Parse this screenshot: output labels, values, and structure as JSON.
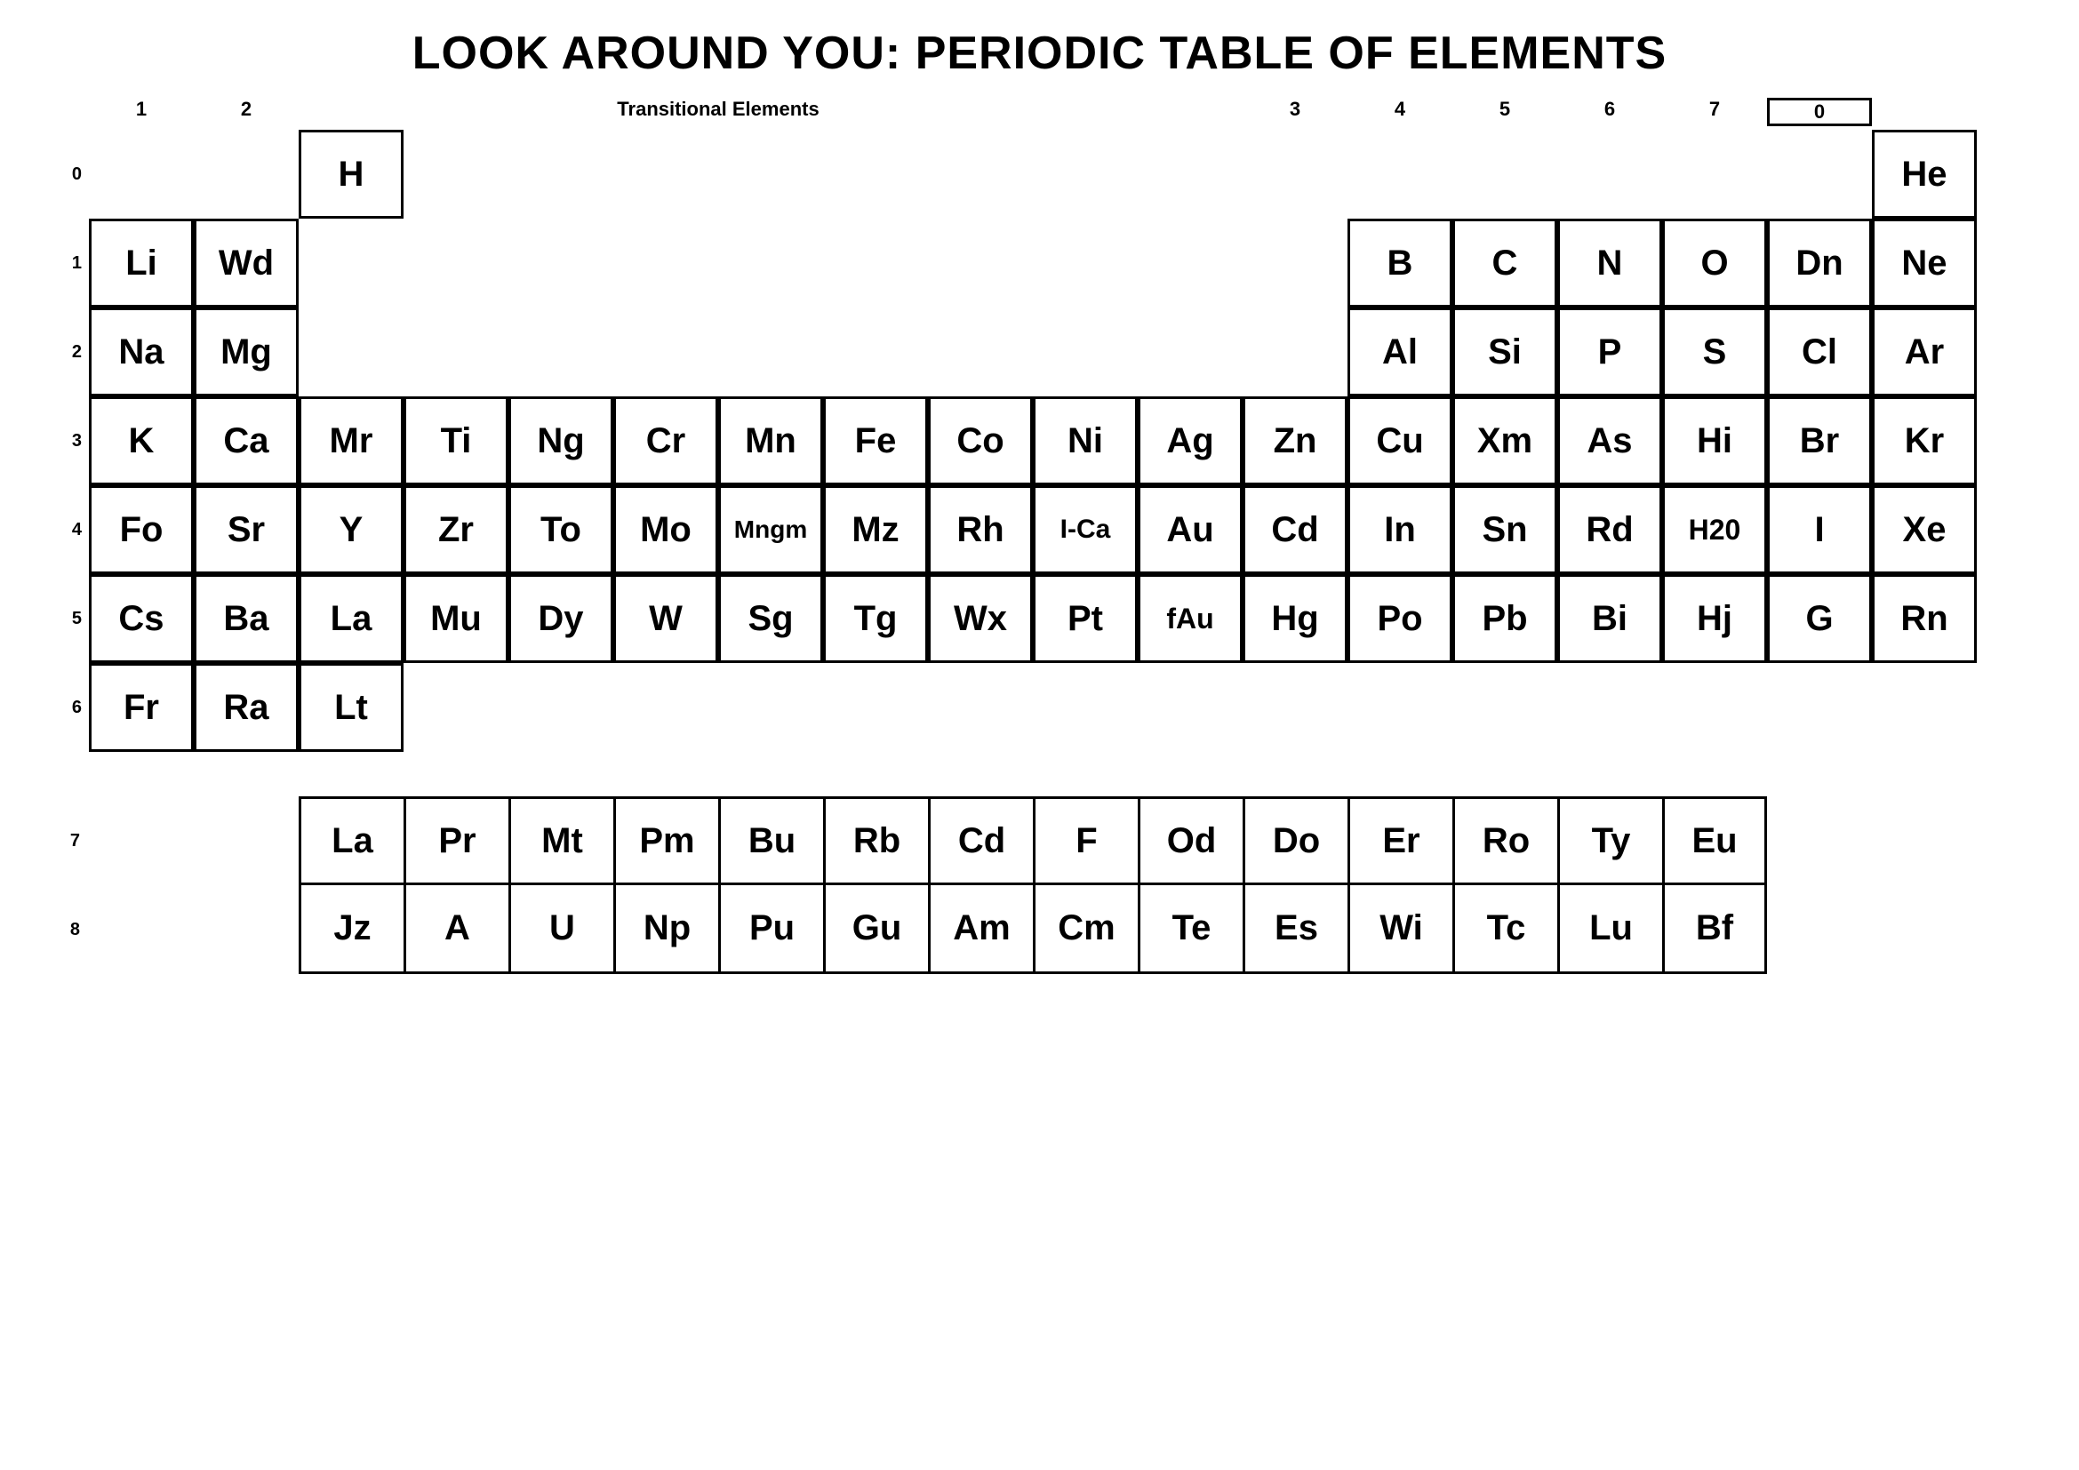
{
  "title": "LOOK AROUND YOU: PERIODIC TABLE OF ELEMENTS",
  "transitional_label": "Transitional Elements",
  "col_headers": [
    "1",
    "2",
    "",
    "",
    "",
    "",
    "",
    "",
    "",
    "",
    "",
    "",
    "3",
    "4",
    "5",
    "6",
    "7",
    "0"
  ],
  "rows": [
    {
      "label": "0",
      "cells": [
        {
          "symbol": "",
          "group": "empty"
        },
        {
          "symbol": "",
          "group": "empty"
        },
        {
          "symbol": "H",
          "group": "box"
        },
        {
          "symbol": "",
          "group": "empty"
        },
        {
          "symbol": "",
          "group": "empty"
        },
        {
          "symbol": "",
          "group": "empty"
        },
        {
          "symbol": "",
          "group": "empty"
        },
        {
          "symbol": "",
          "group": "empty"
        },
        {
          "symbol": "",
          "group": "empty"
        },
        {
          "symbol": "",
          "group": "empty"
        },
        {
          "symbol": "",
          "group": "empty"
        },
        {
          "symbol": "",
          "group": "empty"
        },
        {
          "symbol": "",
          "group": "empty"
        },
        {
          "symbol": "",
          "group": "empty"
        },
        {
          "symbol": "",
          "group": "empty"
        },
        {
          "symbol": "",
          "group": "empty"
        },
        {
          "symbol": "",
          "group": "empty"
        },
        {
          "symbol": "He",
          "group": "box"
        }
      ]
    },
    {
      "label": "1",
      "cells": [
        {
          "symbol": "Li",
          "group": "box"
        },
        {
          "symbol": "Wd",
          "group": "box"
        },
        {
          "symbol": "",
          "group": "empty"
        },
        {
          "symbol": "",
          "group": "empty"
        },
        {
          "symbol": "",
          "group": "empty"
        },
        {
          "symbol": "",
          "group": "empty"
        },
        {
          "symbol": "",
          "group": "empty"
        },
        {
          "symbol": "",
          "group": "empty"
        },
        {
          "symbol": "",
          "group": "empty"
        },
        {
          "symbol": "",
          "group": "empty"
        },
        {
          "symbol": "",
          "group": "empty"
        },
        {
          "symbol": "",
          "group": "empty"
        },
        {
          "symbol": "B",
          "group": "box"
        },
        {
          "symbol": "C",
          "group": "box"
        },
        {
          "symbol": "N",
          "group": "box"
        },
        {
          "symbol": "O",
          "group": "box"
        },
        {
          "symbol": "Dn",
          "group": "box"
        },
        {
          "symbol": "Ne",
          "group": "box"
        }
      ]
    },
    {
      "label": "2",
      "cells": [
        {
          "symbol": "Na",
          "group": "box"
        },
        {
          "symbol": "Mg",
          "group": "box"
        },
        {
          "symbol": "",
          "group": "empty"
        },
        {
          "symbol": "",
          "group": "empty"
        },
        {
          "symbol": "",
          "group": "empty"
        },
        {
          "symbol": "",
          "group": "empty"
        },
        {
          "symbol": "",
          "group": "empty"
        },
        {
          "symbol": "",
          "group": "empty"
        },
        {
          "symbol": "",
          "group": "empty"
        },
        {
          "symbol": "",
          "group": "empty"
        },
        {
          "symbol": "",
          "group": "empty"
        },
        {
          "symbol": "",
          "group": "empty"
        },
        {
          "symbol": "Al",
          "group": "box"
        },
        {
          "symbol": "Si",
          "group": "box"
        },
        {
          "symbol": "P",
          "group": "box"
        },
        {
          "symbol": "S",
          "group": "box"
        },
        {
          "symbol": "Cl",
          "group": "box"
        },
        {
          "symbol": "Ar",
          "group": "box"
        }
      ]
    },
    {
      "label": "3",
      "cells": [
        {
          "symbol": "K",
          "group": "box"
        },
        {
          "symbol": "Ca",
          "group": "box"
        },
        {
          "symbol": "Mr",
          "group": "box"
        },
        {
          "symbol": "Ti",
          "group": "box"
        },
        {
          "symbol": "Ng",
          "group": "box"
        },
        {
          "symbol": "Cr",
          "group": "box"
        },
        {
          "symbol": "Mn",
          "group": "box"
        },
        {
          "symbol": "Fe",
          "group": "box"
        },
        {
          "symbol": "Co",
          "group": "box"
        },
        {
          "symbol": "Ni",
          "group": "box"
        },
        {
          "symbol": "Ag",
          "group": "box"
        },
        {
          "symbol": "Zn",
          "group": "box"
        },
        {
          "symbol": "Cu",
          "group": "box"
        },
        {
          "symbol": "Xm",
          "group": "box"
        },
        {
          "symbol": "As",
          "group": "box"
        },
        {
          "symbol": "Hi",
          "group": "box"
        },
        {
          "symbol": "Br",
          "group": "box"
        },
        {
          "symbol": "Kr",
          "group": "box"
        }
      ]
    },
    {
      "label": "4",
      "cells": [
        {
          "symbol": "Fo",
          "group": "box"
        },
        {
          "symbol": "Sr",
          "group": "box"
        },
        {
          "symbol": "Y",
          "group": "box"
        },
        {
          "symbol": "Zr",
          "group": "box"
        },
        {
          "symbol": "To",
          "group": "box"
        },
        {
          "symbol": "Mo",
          "group": "box"
        },
        {
          "symbol": "Mngm",
          "group": "box",
          "small": true
        },
        {
          "symbol": "Mz",
          "group": "box"
        },
        {
          "symbol": "Rh",
          "group": "box"
        },
        {
          "symbol": "I-Ca",
          "group": "box",
          "small": true
        },
        {
          "symbol": "Au",
          "group": "box"
        },
        {
          "symbol": "Cd",
          "group": "box"
        },
        {
          "symbol": "In",
          "group": "box"
        },
        {
          "symbol": "Sn",
          "group": "box"
        },
        {
          "symbol": "Rd",
          "group": "box"
        },
        {
          "symbol": "H20",
          "group": "box",
          "small": true
        },
        {
          "symbol": "I",
          "group": "box"
        },
        {
          "symbol": "Xe",
          "group": "box"
        }
      ]
    },
    {
      "label": "5",
      "cells": [
        {
          "symbol": "Cs",
          "group": "box"
        },
        {
          "symbol": "Ba",
          "group": "box"
        },
        {
          "symbol": "La",
          "group": "box"
        },
        {
          "symbol": "Mu",
          "group": "box"
        },
        {
          "symbol": "Dy",
          "group": "box"
        },
        {
          "symbol": "W",
          "group": "box"
        },
        {
          "symbol": "Sg",
          "group": "box"
        },
        {
          "symbol": "Tg",
          "group": "box"
        },
        {
          "symbol": "Wx",
          "group": "box"
        },
        {
          "symbol": "Pt",
          "group": "box"
        },
        {
          "symbol": "fAu",
          "group": "box",
          "small": true
        },
        {
          "symbol": "Hg",
          "group": "box"
        },
        {
          "symbol": "Po",
          "group": "box"
        },
        {
          "symbol": "Pb",
          "group": "box"
        },
        {
          "symbol": "Bi",
          "group": "box"
        },
        {
          "symbol": "Hj",
          "group": "box"
        },
        {
          "symbol": "G",
          "group": "box"
        },
        {
          "symbol": "Rn",
          "group": "box"
        }
      ]
    },
    {
      "label": "6",
      "cells": [
        {
          "symbol": "Fr",
          "group": "box"
        },
        {
          "symbol": "Ra",
          "group": "box"
        },
        {
          "symbol": "Lt",
          "group": "box"
        },
        {
          "symbol": "",
          "group": "empty"
        },
        {
          "symbol": "",
          "group": "empty"
        },
        {
          "symbol": "",
          "group": "empty"
        },
        {
          "symbol": "",
          "group": "empty"
        },
        {
          "symbol": "",
          "group": "empty"
        },
        {
          "symbol": "",
          "group": "empty"
        },
        {
          "symbol": "",
          "group": "empty"
        },
        {
          "symbol": "",
          "group": "empty"
        },
        {
          "symbol": "",
          "group": "empty"
        },
        {
          "symbol": "",
          "group": "empty"
        },
        {
          "symbol": "",
          "group": "empty"
        },
        {
          "symbol": "",
          "group": "empty"
        },
        {
          "symbol": "",
          "group": "empty"
        },
        {
          "symbol": "",
          "group": "empty"
        },
        {
          "symbol": "",
          "group": "empty"
        }
      ]
    }
  ],
  "lower_rows": [
    {
      "label": "7",
      "cells": [
        "La",
        "Pr",
        "Mt",
        "Pm",
        "Bu",
        "Rb",
        "Cd",
        "F",
        "Od",
        "Do",
        "Er",
        "Ro",
        "Ty",
        "Eu"
      ]
    },
    {
      "label": "8",
      "cells": [
        "Jz",
        "A",
        "U",
        "Np",
        "Pu",
        "Gu",
        "Am",
        "Cm",
        "Te",
        "Es",
        "Wi",
        "Tc",
        "Lu",
        "Bf"
      ]
    }
  ]
}
